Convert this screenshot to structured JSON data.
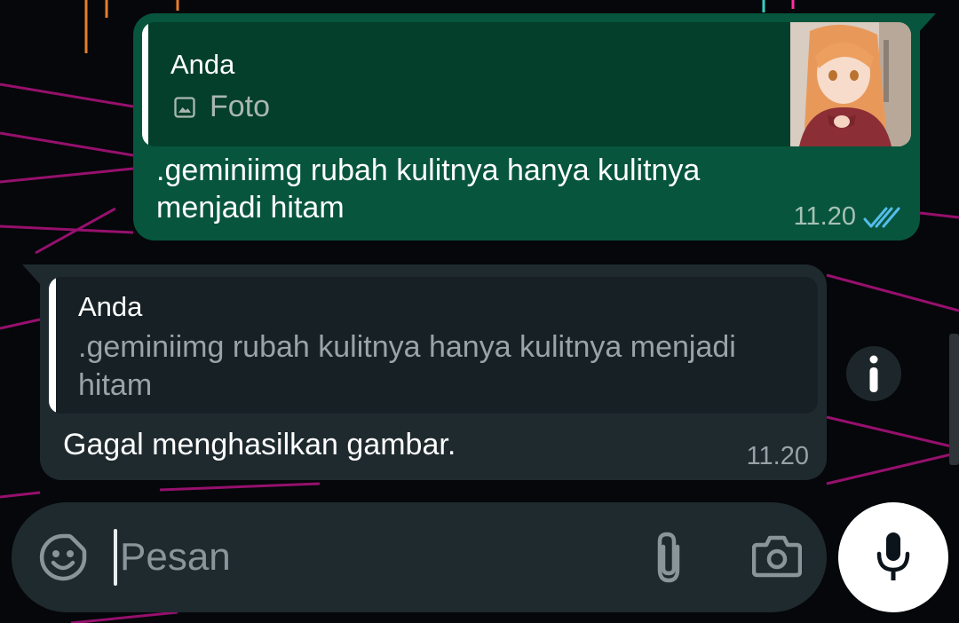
{
  "messages": [
    {
      "direction": "outgoing",
      "reply_to": {
        "author": "Anda",
        "icon": "image-icon",
        "preview_label": "Foto",
        "has_thumbnail": true
      },
      "text": ".geminiimg rubah kulitnya hanya kulitnya menjadi hitam",
      "time": "11.20",
      "status": "read"
    },
    {
      "direction": "incoming",
      "reply_to": {
        "author": "Anda",
        "preview_text": ".geminiimg rubah kulitnya hanya kulitnya menjadi hitam"
      },
      "text": "Gagal menghasilkan gambar.",
      "time": "11.20"
    }
  ],
  "composer": {
    "placeholder": "Pesan",
    "value": "",
    "icons": [
      "sticker-icon",
      "paperclip-icon",
      "camera-icon",
      "microphone-icon"
    ]
  },
  "colors": {
    "outgoing_bubble": "#07553c",
    "incoming_bubble": "#1f2a2f",
    "read_ticks": "#53bdeb",
    "wallpaper_lines": "#c0168e"
  }
}
